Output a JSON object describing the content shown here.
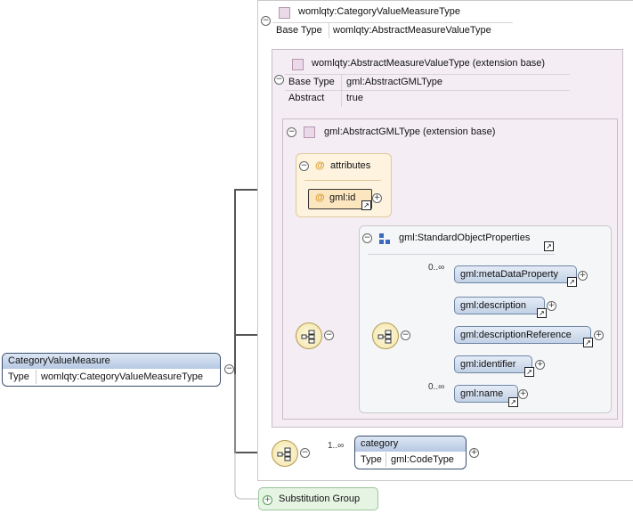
{
  "root": {
    "name": "CategoryValueMeasure",
    "type_label": "Type",
    "type_value": "womlqty:CategoryValueMeasureType"
  },
  "complex_type": {
    "name": "womlqty:CategoryValueMeasureType",
    "base_label": "Base Type",
    "base_value": "womlqty:AbstractMeasureValueType"
  },
  "extension1": {
    "name": "womlqty:AbstractMeasureValueType (extension base)",
    "base_label": "Base Type",
    "base_value": "gml:AbstractGMLType",
    "abstract_label": "Abstract",
    "abstract_value": "true"
  },
  "extension2": {
    "name": "gml:AbstractGMLType (extension base)"
  },
  "attributes": {
    "title": "attributes",
    "attr_symbol": "@",
    "items": [
      "gml:id"
    ]
  },
  "group": {
    "name": "gml:StandardObjectProperties",
    "elements": [
      {
        "name": "gml:metaDataProperty",
        "cardinality": "0..∞"
      },
      {
        "name": "gml:description",
        "cardinality": ""
      },
      {
        "name": "gml:descriptionReference",
        "cardinality": ""
      },
      {
        "name": "gml:identifier",
        "cardinality": ""
      },
      {
        "name": "gml:name",
        "cardinality": "0..∞"
      }
    ]
  },
  "category": {
    "name": "category",
    "cardinality": "1..∞",
    "type_label": "Type",
    "type_value": "gml:CodeType"
  },
  "substitution": {
    "label": "Substitution Group"
  },
  "symbols": {
    "collapse": "−",
    "expand": "+",
    "reference": "↗"
  },
  "colors": {
    "element_fill": "#c2d1e6",
    "extension_fill": "#f4eef4",
    "attributes_fill": "#fdf3de",
    "substitution_fill": "#e6f4e4"
  }
}
